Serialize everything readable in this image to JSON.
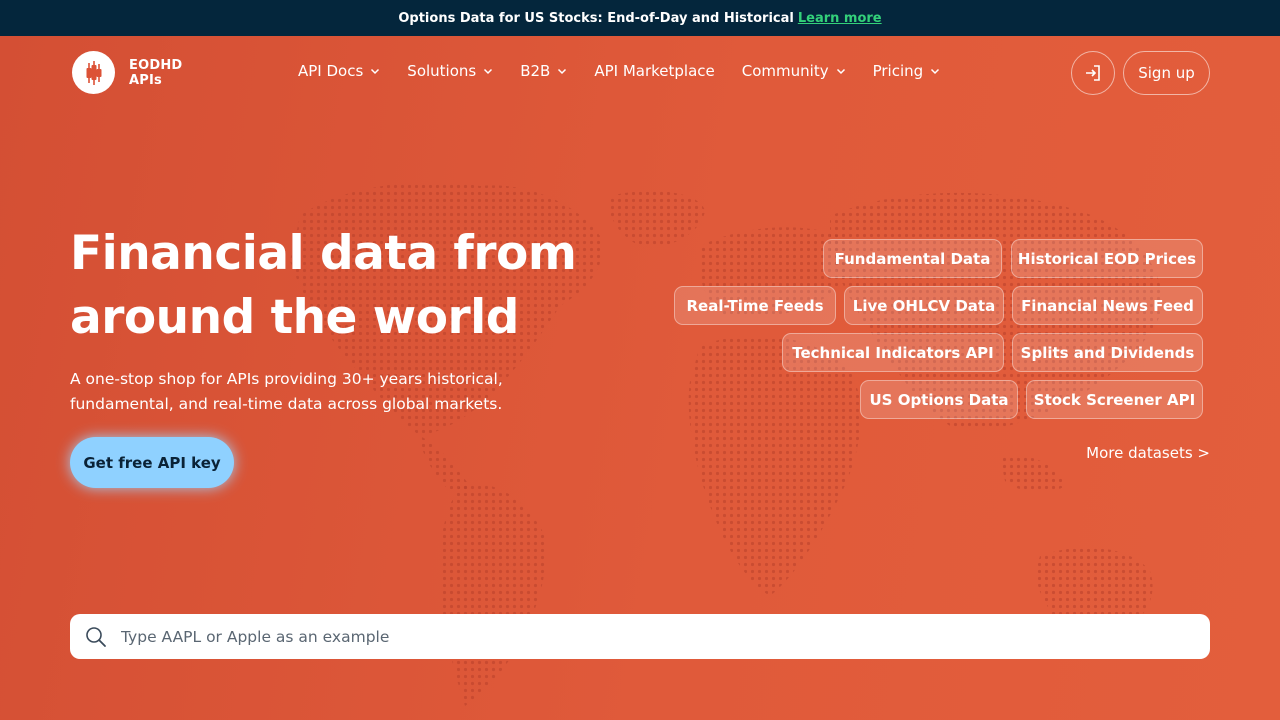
{
  "colors": {
    "announcement_bg": "#04263c",
    "hero_bg": "#dc5236",
    "link_green": "#33d17a",
    "cta_bg": "#8fd1ff",
    "cta_text": "#0a2236"
  },
  "announcement": {
    "text": "Options Data for US Stocks: End-of-Day and Historical",
    "link": "Learn more"
  },
  "logo": {
    "line1": "EODHD",
    "line2": "APIs",
    "icon": "candlestick-chart-icon"
  },
  "nav": {
    "items": [
      {
        "label": "API Docs",
        "dropdown": true
      },
      {
        "label": "Solutions",
        "dropdown": true
      },
      {
        "label": "B2B",
        "dropdown": true
      },
      {
        "label": "API Marketplace",
        "dropdown": false
      },
      {
        "label": "Community",
        "dropdown": true
      },
      {
        "label": "Pricing",
        "dropdown": true
      }
    ],
    "login_icon": "login-icon",
    "signup_label": "Sign up"
  },
  "hero": {
    "headline_line1": "Financial data from",
    "headline_line2": "around the world",
    "subheadline": "A one-stop shop for APIs providing 30+ years historical, fundamental, and real-time data across global markets.",
    "cta_label": "Get free API key"
  },
  "datasets": {
    "chips": [
      "Fundamental Data",
      "Historical EOD Prices",
      "Real-Time Feeds",
      "Live OHLCV Data",
      "Financial News Feed",
      "Technical Indicators API",
      "Splits and Dividends",
      "US Options Data",
      "Stock Screener API"
    ],
    "more_label": "More datasets >"
  },
  "search": {
    "placeholder": "Type AAPL or Apple as an example",
    "value": ""
  }
}
